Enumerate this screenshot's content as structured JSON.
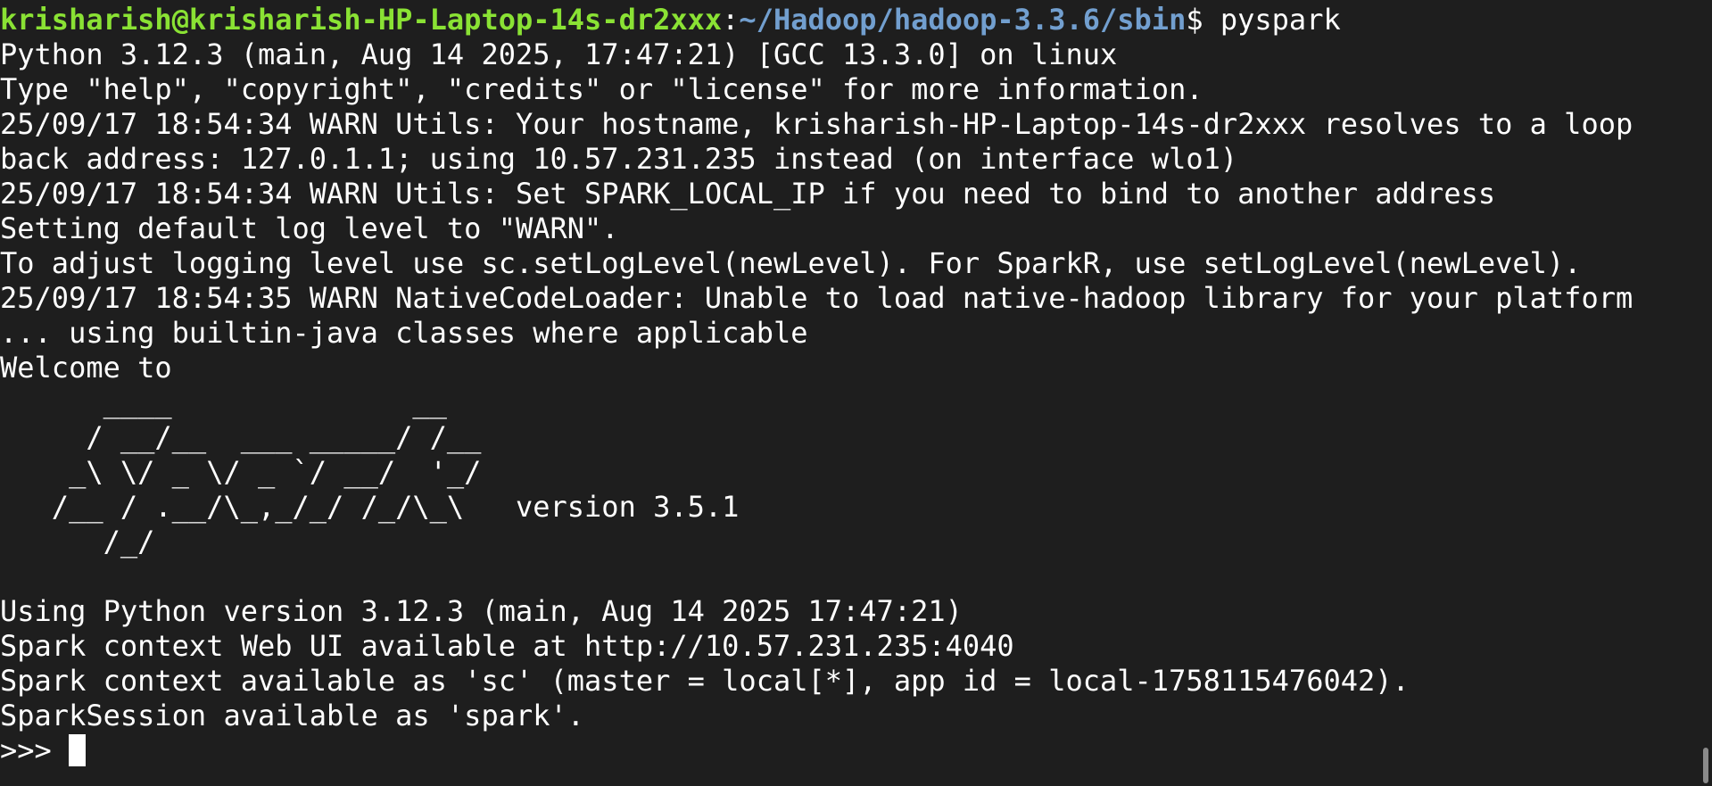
{
  "prompt": {
    "user_host": "krisharish@krisharish-HP-Laptop-14s-dr2xxx",
    "colon": ":",
    "path": "~/Hadoop/hadoop-3.3.6/sbin",
    "dollar": "$",
    "command": " pyspark"
  },
  "output_lines": [
    "Python 3.12.3 (main, Aug 14 2025, 17:47:21) [GCC 13.3.0] on linux",
    "Type \"help\", \"copyright\", \"credits\" or \"license\" for more information.",
    "25/09/17 18:54:34 WARN Utils: Your hostname, krisharish-HP-Laptop-14s-dr2xxx resolves to a loop",
    "back address: 127.0.1.1; using 10.57.231.235 instead (on interface wlo1)",
    "25/09/17 18:54:34 WARN Utils: Set SPARK_LOCAL_IP if you need to bind to another address",
    "Setting default log level to \"WARN\".",
    "To adjust logging level use sc.setLogLevel(newLevel). For SparkR, use setLogLevel(newLevel).",
    "25/09/17 18:54:35 WARN NativeCodeLoader: Unable to load native-hadoop library for your platform",
    "... using builtin-java classes where applicable",
    "Welcome to",
    "      ____              __",
    "     / __/__  ___ _____/ /__",
    "    _\\ \\/ _ \\/ _ `/ __/  '_/",
    "   /__ / .__/\\_,_/_/ /_/\\_\\   version 3.5.1",
    "      /_/",
    "",
    "Using Python version 3.12.3 (main, Aug 14 2025 17:47:21)",
    "Spark context Web UI available at http://10.57.231.235:4040",
    "Spark context available as 'sc' (master = local[*], app id = local-1758115476042).",
    "SparkSession available as 'spark'."
  ],
  "repl_prompt": ">>> ",
  "colors": {
    "background": "#1e1e1e",
    "foreground": "#ffffff",
    "prompt_user": "#8ae234",
    "prompt_path": "#729fcf"
  }
}
